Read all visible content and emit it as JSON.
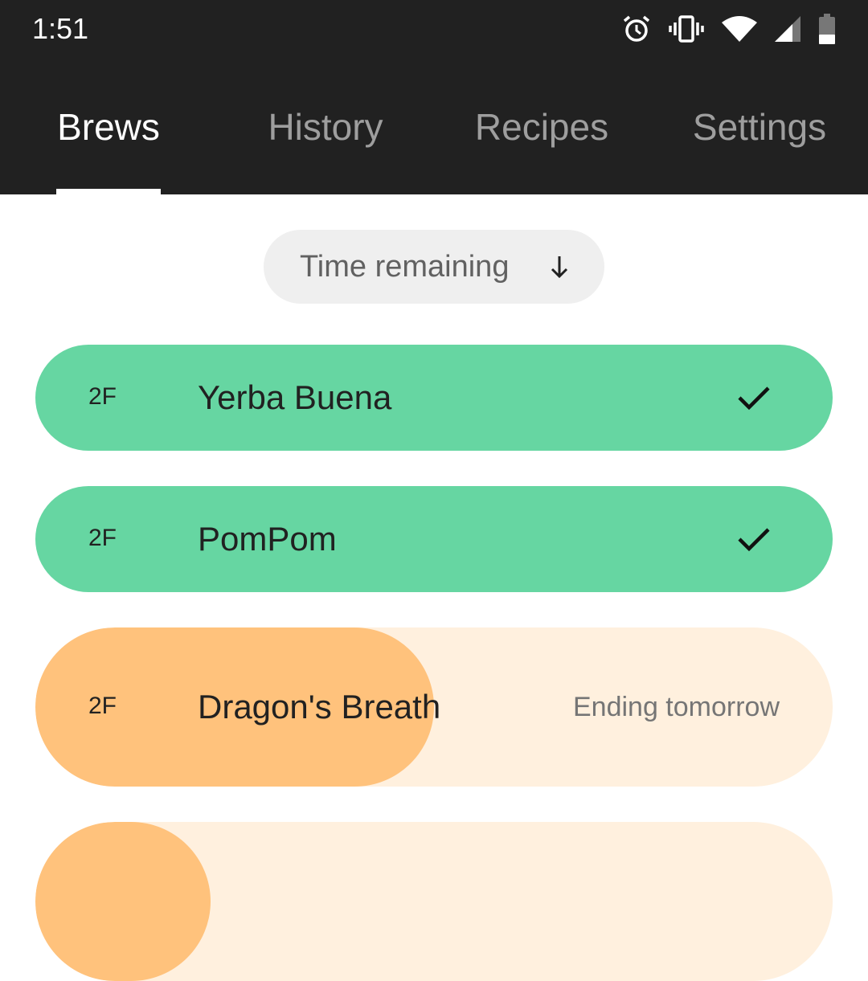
{
  "status_bar": {
    "time": "1:51",
    "icons": [
      "alarm-icon",
      "vibrate-icon",
      "wifi-icon",
      "cellular-signal-icon",
      "battery-icon"
    ]
  },
  "tabs": [
    {
      "label": "Brews",
      "active": true
    },
    {
      "label": "History",
      "active": false
    },
    {
      "label": "Recipes",
      "active": false
    },
    {
      "label": "Settings",
      "active": false
    }
  ],
  "sort": {
    "label": "Time remaining",
    "direction_icon": "arrow-down-icon"
  },
  "brews": [
    {
      "code": "2F",
      "name": "Yerba Buena",
      "status": "",
      "state": "done",
      "icon": "check-icon",
      "progress": 1.0
    },
    {
      "code": "2F",
      "name": "PomPom",
      "status": "",
      "state": "done",
      "icon": "check-icon",
      "progress": 1.0
    },
    {
      "code": "2F",
      "name": "Dragon's Breath",
      "status": "Ending tomorrow",
      "state": "in-progress",
      "progress": 0.5
    },
    {
      "code": "",
      "name": "",
      "status": "",
      "state": "in-progress",
      "progress": 0.22
    }
  ],
  "colors": {
    "topbar": "#212121",
    "tab_inactive": "#9e9e9e",
    "tab_active": "#ffffff",
    "chip_bg": "#efefef",
    "done_green": "#66d6a2",
    "progress_orange": "#ffc27c",
    "progress_track": "#fff0de"
  }
}
